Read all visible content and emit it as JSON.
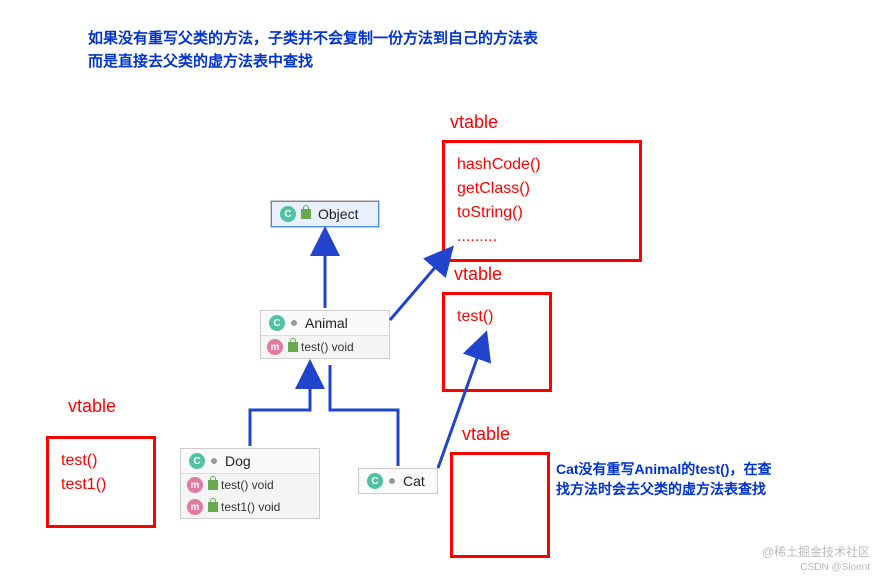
{
  "header": {
    "line1": "如果没有重写父类的方法，子类并不会复制一份方法到自己的方法表",
    "line2": "而是直接去父类的虚方法表中查找"
  },
  "classes": {
    "object": {
      "name": "Object"
    },
    "animal": {
      "name": "Animal",
      "method1": "test() void"
    },
    "dog": {
      "name": "Dog",
      "method1": "test()  void",
      "method2": "test1() void"
    },
    "cat": {
      "name": "Cat"
    }
  },
  "vtables": {
    "objectLabel": "vtable",
    "objectBox": {
      "l1": "hashCode()",
      "l2": "getClass()",
      "l3": "toString()",
      "l4": "........."
    },
    "animalLabel": "vtable",
    "animalBox": {
      "l1": "test()"
    },
    "dogLabel": "vtable",
    "dogBox": {
      "l1": "test()",
      "l2": "test1()"
    },
    "catLabel": "vtable"
  },
  "catNote": {
    "line1": "Cat没有重写Animal的test()，在查",
    "line2": "找方法时会去父类的虚方法表查找"
  },
  "watermark": {
    "main": "@稀土掘金技术社区",
    "sub": "CSDN @Sloent"
  }
}
